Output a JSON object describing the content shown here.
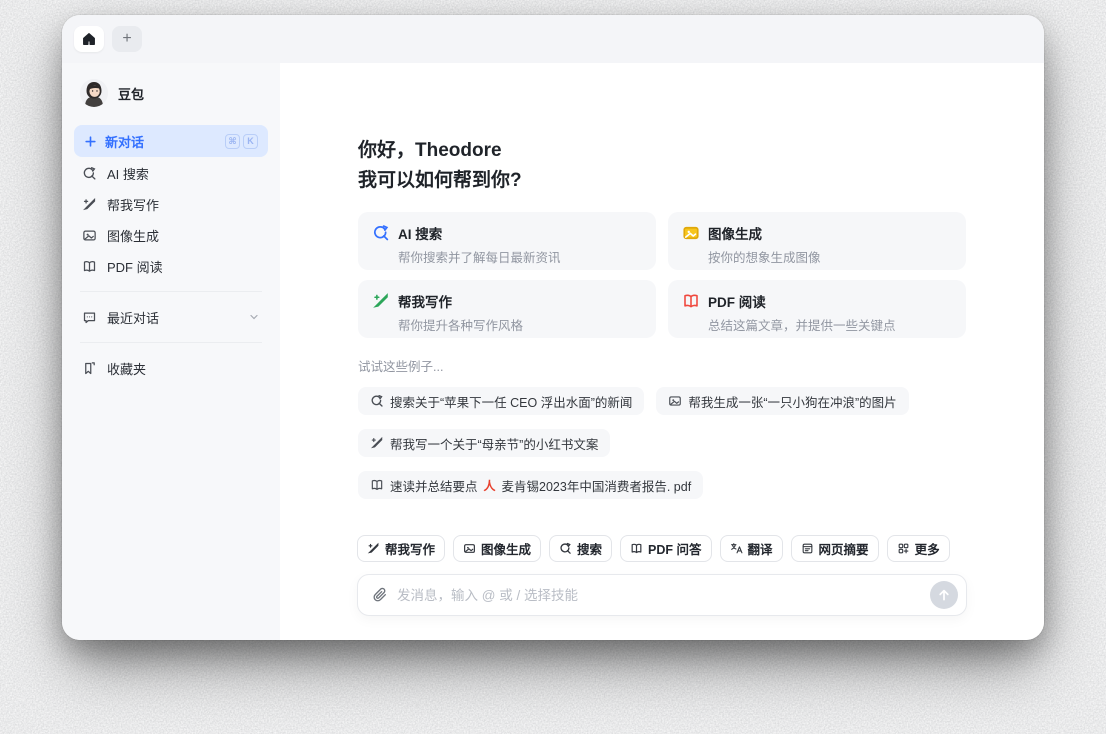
{
  "colors": {
    "brand_blue": "#3370ff",
    "card_search": "#3370ff",
    "card_image": "#f0b90b",
    "card_write": "#2ca65a",
    "card_pdf": "#f0483e",
    "new_chat_bg": "#dde9ff",
    "send_button_bg": "#d5d9e0"
  },
  "tabbar": {
    "home_tab_icon": "home-icon",
    "new_tab_label": "+"
  },
  "sidebar": {
    "profile": {
      "name": "豆包",
      "avatar_icon": "doubao-avatar"
    },
    "new_chat": {
      "label": "新对话",
      "keys": [
        "⌘",
        "K"
      ]
    },
    "items": [
      {
        "label": "AI 搜索",
        "icon": "ai-search-icon"
      },
      {
        "label": "帮我写作",
        "icon": "write-icon"
      },
      {
        "label": "图像生成",
        "icon": "image-gen-icon"
      },
      {
        "label": "PDF 阅读",
        "icon": "pdf-read-icon"
      }
    ],
    "sections": [
      {
        "label": "最近对话",
        "icon": "chat-bubble-icon",
        "chevron": "chevron-down-icon"
      },
      {
        "label": "收藏夹",
        "icon": "bookmark-icon"
      }
    ]
  },
  "main": {
    "greeting_line1": "你好，Theodore",
    "greeting_line2": "我可以如何帮到你?",
    "cards": [
      {
        "title": "AI 搜索",
        "desc": "帮你搜索并了解每日最新资讯",
        "icon": "ai-search-icon"
      },
      {
        "title": "图像生成",
        "desc": "按你的想象生成图像",
        "icon": "image-gen-icon"
      },
      {
        "title": "帮我写作",
        "desc": "帮你提升各种写作风格",
        "icon": "write-icon"
      },
      {
        "title": "PDF 阅读",
        "desc": "总结这篇文章，并提供一些关键点",
        "icon": "pdf-read-icon"
      }
    ],
    "examples_label": "试试这些例子...",
    "examples": [
      {
        "text": "搜索关于“苹果下一任 CEO 浮出水面”的新闻",
        "icon": "search-icon"
      },
      {
        "text": "帮我生成一张“一只小狗在冲浪”的图片",
        "icon": "image-gen-icon"
      },
      {
        "text": "帮我写一个关于“母亲节”的小红书文案",
        "icon": "write-icon"
      },
      {
        "text": "速读并总结要点",
        "icon": "pdf-read-icon",
        "attachment": "麦肯锡2023年中国消费者报告. pdf",
        "attachment_icon": "pdf-file-icon"
      }
    ]
  },
  "composer": {
    "skills": [
      {
        "label": "帮我写作",
        "icon": "write-icon"
      },
      {
        "label": "图像生成",
        "icon": "image-gen-icon"
      },
      {
        "label": "搜索",
        "icon": "search-icon"
      },
      {
        "label": "PDF 问答",
        "icon": "pdf-read-icon"
      },
      {
        "label": "翻译",
        "icon": "translate-icon"
      },
      {
        "label": "网页摘要",
        "icon": "webpage-icon"
      },
      {
        "label": "更多",
        "icon": "more-grid-icon"
      }
    ],
    "input": {
      "placeholder": "发消息，输入 @ 或 / 选择技能",
      "attach_icon": "paperclip-icon",
      "send_icon": "send-arrow-icon"
    }
  }
}
